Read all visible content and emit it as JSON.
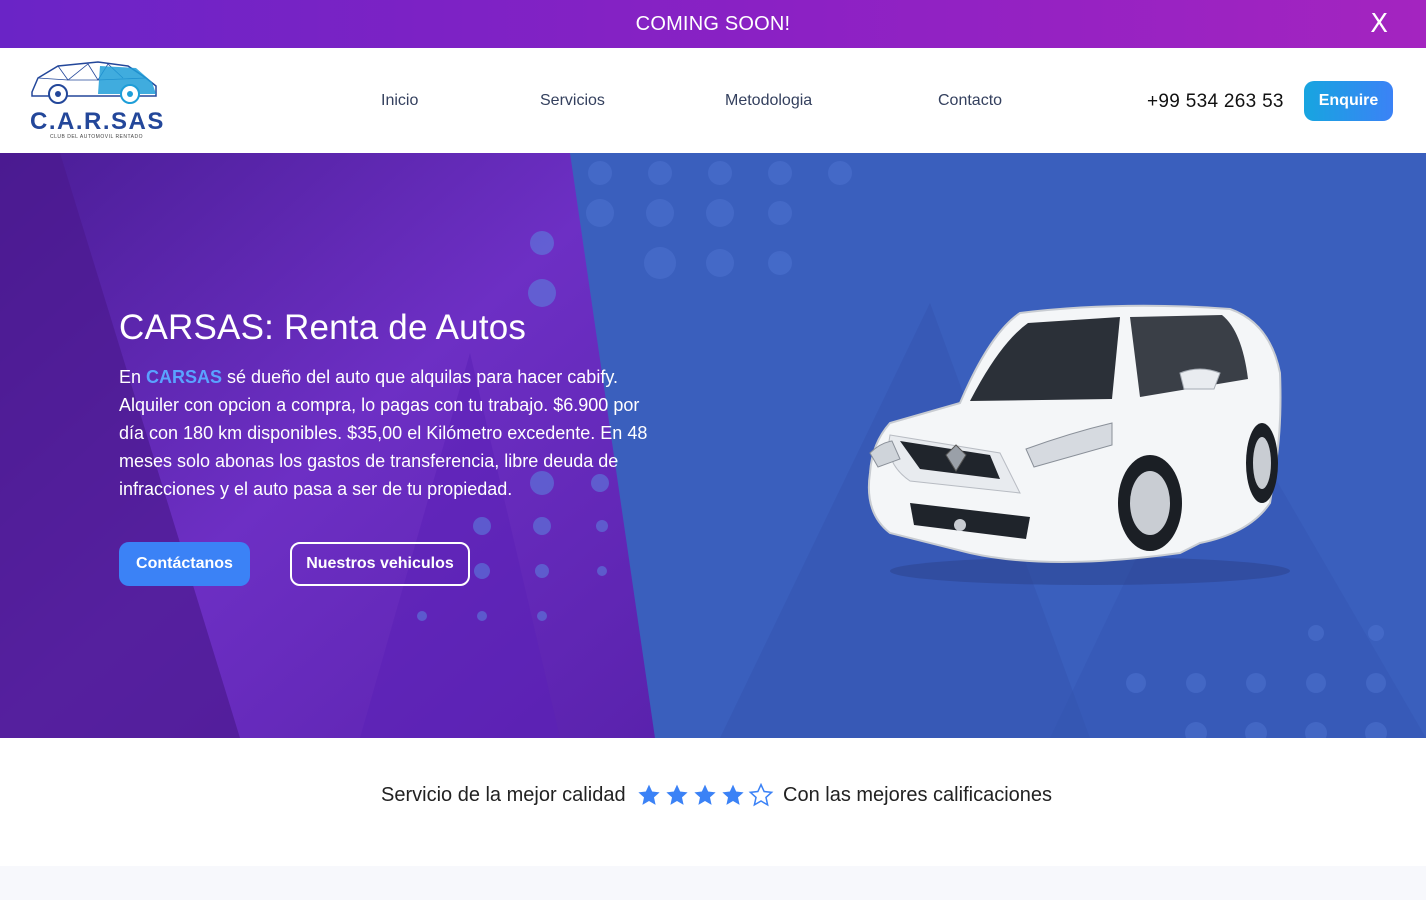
{
  "announcement": {
    "text": "COMING SOON!",
    "close_label": "X"
  },
  "header": {
    "logo": {
      "brand": "C.A.R.SAS",
      "tagline": "CLUB DEL AUTOMOVIL RENTADO"
    },
    "nav": [
      "Inicio",
      "Servicios",
      "Metodologia",
      "Contacto"
    ],
    "phone": "+99 534 263 53",
    "enquire_label": "Enquire"
  },
  "hero": {
    "title": "CARSAS: Renta de Autos",
    "desc_prefix": "En ",
    "desc_highlight": "CARSAS",
    "desc_body": " sé dueño del auto que alquilas para hacer cabify. Alquiler con opcion a compra, lo pagas con tu trabajo. $6.900 por día con 180 km disponibles. $35,00 el Kilómetro excedente. En 48 meses solo abonas los gastos de transferencia, libre deuda de infracciones y el auto pasa a ser de tu propiedad.",
    "primary_button": "Contáctanos",
    "secondary_button": "Nuestros vehiculos"
  },
  "rating": {
    "left_text": "Servicio de la mejor calidad",
    "right_text": "Con las mejores calificaciones",
    "stars_filled": 4,
    "stars_total": 5,
    "star_color": "#3b82f6"
  },
  "colors": {
    "announce_gradient": [
      "#6a24c6",
      "#a424c0"
    ],
    "hero_blue": "#3a5fbd",
    "hero_purple": "#6b2bbf",
    "accent": "#3b82f6"
  }
}
